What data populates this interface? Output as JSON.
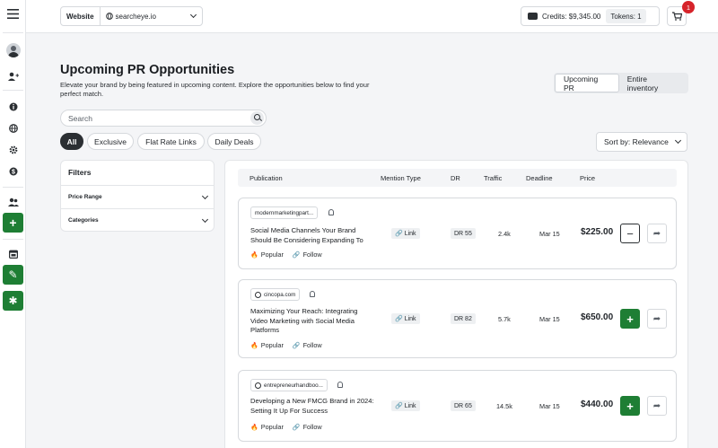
{
  "sidebar": {
    "menu_icon": "hamburger-menu-icon",
    "items": [
      {
        "icon": "avatar"
      },
      {
        "icon": "add-user-icon"
      },
      {
        "icon": "info-icon"
      },
      {
        "icon": "globe-icon"
      },
      {
        "icon": "gear-icon"
      },
      {
        "icon": "dollar-icon"
      },
      {
        "icon": "users-icon"
      },
      {
        "icon": "plus-icon",
        "glyph": "+"
      },
      {
        "icon": "calendar-icon"
      },
      {
        "icon": "pencil-icon",
        "glyph": "✎"
      },
      {
        "icon": "bug-icon",
        "glyph": "✱"
      }
    ]
  },
  "topbar": {
    "website_label": "Website",
    "website_value": "searcheye.io",
    "credits": "Credits: $9,345.00",
    "tokens": "Tokens: 1",
    "cart_icon": "🛒",
    "cart_count": "1"
  },
  "header": {
    "title": "Upcoming PR Opportunities",
    "subtitle": "Elevate your brand by being featured in upcoming content. Explore the opportunities below to find your perfect match.",
    "toggle": [
      "Upcoming PR",
      "Entire inventory"
    ]
  },
  "search": {
    "placeholder": "Search"
  },
  "chips": [
    "All",
    "Exclusive",
    "Flat Rate Links",
    "Daily Deals"
  ],
  "sort": {
    "label": "Sort by: Relevance"
  },
  "filters": {
    "title": "Filters",
    "items": [
      "Price Range",
      "Categories"
    ]
  },
  "table": {
    "headers": [
      "Publication",
      "Mention Type",
      "DR",
      "Traffic",
      "Deadline",
      "Price"
    ],
    "rows": [
      {
        "domain": "modernmarketingpart...",
        "title": "Social Media Channels Your Brand Should Be Considering Expanding To",
        "popular": "Popular",
        "follow": "Follow",
        "mention": "Link",
        "dr": "DR 55",
        "traffic": "2.4k",
        "deadline": "Mar 15",
        "price": "$225.00",
        "action": "−"
      },
      {
        "domain": "cincopa.com",
        "title": "Maximizing Your Reach: Integrating Video Marketing with Social Media Platforms",
        "popular": "Popular",
        "follow": "Follow",
        "mention": "Link",
        "dr": "DR 82",
        "traffic": "5.7k",
        "deadline": "Mar 15",
        "price": "$650.00",
        "action": "+"
      },
      {
        "domain": "entrepreneurhandboo...",
        "title": "Developing a New FMCG Brand in 2024: Setting It Up For Success",
        "popular": "Popular",
        "follow": "Follow",
        "mention": "Link",
        "dr": "DR 65",
        "traffic": "14.5k",
        "deadline": "Mar 15",
        "price": "$440.00",
        "action": "+"
      }
    ]
  },
  "colors": {
    "accent": "#1e7e34",
    "badge": "#d6232a",
    "dark": "#2b2f33"
  }
}
